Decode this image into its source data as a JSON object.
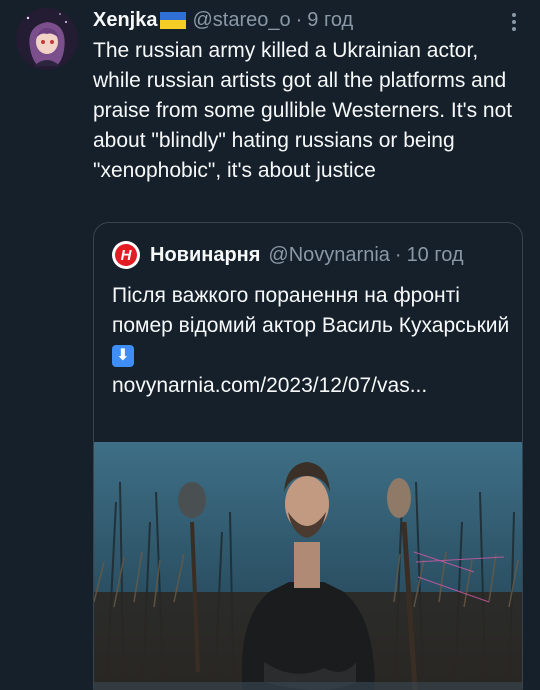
{
  "tweet": {
    "display_name": "Xenjka",
    "flag_icon": "ukraine-flag-icon",
    "handle": "@stareo_o",
    "separator": "·",
    "time": "9 год",
    "text": "The russian army killed a Ukrainian actor, while russian artists got all the platforms and praise from some gullible Westerners. It's not about \"blindly\" hating russians or being \"xenophobic\", it's about justice"
  },
  "quote": {
    "display_name": "Новинарня",
    "handle": "@Novynarnia",
    "separator": "·",
    "time": "10 год",
    "logo_icon": "novynarnia-logo-icon",
    "text_line": "Після важкого поранення на фронті помер відомий актор Василь Кухарський",
    "arrow_emoji": "⬇",
    "link": "novynarnia.com/2023/12/07/vas..."
  },
  "colors": {
    "background": "#15202b",
    "text": "#f7f9f9",
    "secondary": "#8b98a5",
    "border": "#38444d"
  }
}
